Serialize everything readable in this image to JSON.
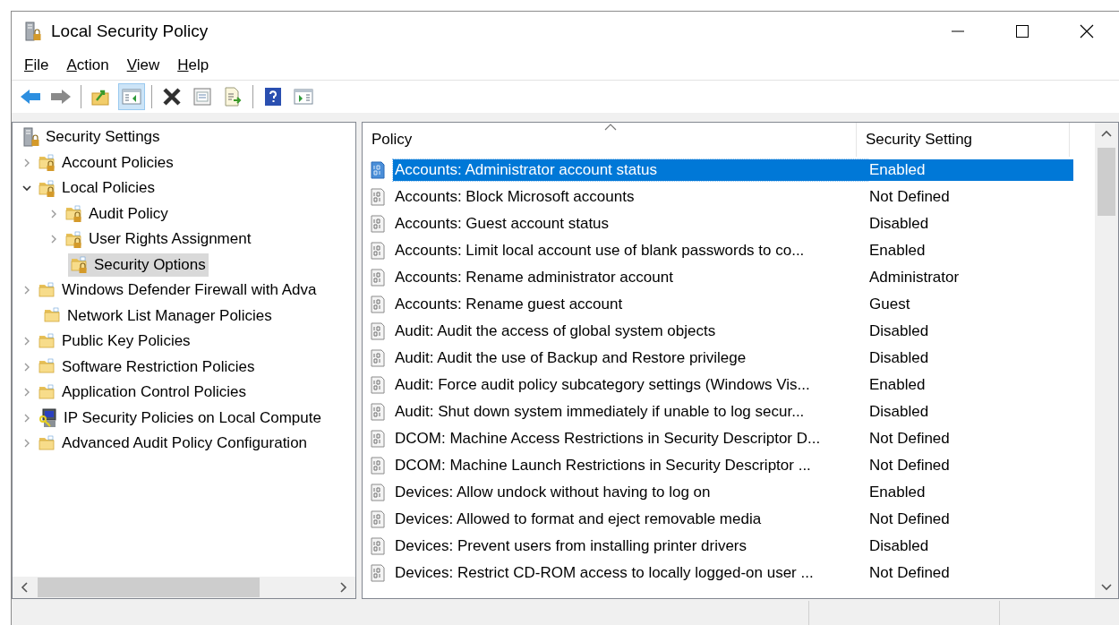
{
  "window": {
    "title": "Local Security Policy"
  },
  "menu": [
    {
      "label": "File"
    },
    {
      "label": "Action"
    },
    {
      "label": "View"
    },
    {
      "label": "Help"
    }
  ],
  "toolbar": [
    {
      "kind": "back",
      "pressed": false
    },
    {
      "kind": "forward",
      "pressed": false
    },
    {
      "kind": "separator"
    },
    {
      "kind": "up",
      "pressed": false
    },
    {
      "kind": "tree_toggle",
      "pressed": true
    },
    {
      "kind": "separator"
    },
    {
      "kind": "delete",
      "pressed": false
    },
    {
      "kind": "properties",
      "pressed": false
    },
    {
      "kind": "export",
      "pressed": false
    },
    {
      "kind": "separator"
    },
    {
      "kind": "help",
      "pressed": false
    },
    {
      "kind": "action_toggle",
      "pressed": false
    }
  ],
  "tree": [
    {
      "label": "Security Settings",
      "kind": "server",
      "selected": false,
      "children": [
        {
          "label": "Account Policies",
          "kind": "locked_folder",
          "expanded": false,
          "selected": false
        },
        {
          "label": "Local Policies",
          "kind": "locked_folder",
          "expanded": true,
          "selected": false,
          "children": [
            {
              "label": "Audit Policy",
              "kind": "locked_folder",
              "expanded": false,
              "selected": false
            },
            {
              "label": "User Rights Assignment",
              "kind": "locked_folder",
              "expanded": false,
              "selected": false
            },
            {
              "label": "Security Options",
              "kind": "locked_folder",
              "selected": true
            }
          ]
        },
        {
          "label": "Windows Defender Firewall with Adva",
          "kind": "folder",
          "expanded": false,
          "selected": false
        },
        {
          "label": "Network List Manager Policies",
          "kind": "folder",
          "selected": false
        },
        {
          "label": "Public Key Policies",
          "kind": "folder",
          "expanded": false,
          "selected": false
        },
        {
          "label": "Software Restriction Policies",
          "kind": "folder",
          "expanded": false,
          "selected": false
        },
        {
          "label": "Application Control Policies",
          "kind": "folder",
          "expanded": false,
          "selected": false
        },
        {
          "label": "IP Security Policies on Local Compute",
          "kind": "computer_key",
          "expanded": false,
          "selected": false
        },
        {
          "label": "Advanced Audit Policy Configuration",
          "kind": "folder",
          "expanded": false,
          "selected": false
        }
      ]
    }
  ],
  "table": {
    "columns": [
      {
        "label": "Policy",
        "sorted": true
      },
      {
        "label": "Security Setting",
        "sorted": false
      }
    ],
    "rows": [
      {
        "policy": "Accounts: Administrator account status",
        "setting": "Enabled",
        "selected": true
      },
      {
        "policy": "Accounts: Block Microsoft accounts",
        "setting": "Not Defined",
        "selected": false
      },
      {
        "policy": "Accounts: Guest account status",
        "setting": "Disabled",
        "selected": false
      },
      {
        "policy": "Accounts: Limit local account use of blank passwords to co...",
        "setting": "Enabled",
        "selected": false
      },
      {
        "policy": "Accounts: Rename administrator account",
        "setting": "Administrator",
        "selected": false
      },
      {
        "policy": "Accounts: Rename guest account",
        "setting": "Guest",
        "selected": false
      },
      {
        "policy": "Audit: Audit the access of global system objects",
        "setting": "Disabled",
        "selected": false
      },
      {
        "policy": "Audit: Audit the use of Backup and Restore privilege",
        "setting": "Disabled",
        "selected": false
      },
      {
        "policy": "Audit: Force audit policy subcategory settings (Windows Vis...",
        "setting": "Enabled",
        "selected": false
      },
      {
        "policy": "Audit: Shut down system immediately if unable to log secur...",
        "setting": "Disabled",
        "selected": false
      },
      {
        "policy": "DCOM: Machine Access Restrictions in Security Descriptor D...",
        "setting": "Not Defined",
        "selected": false
      },
      {
        "policy": "DCOM: Machine Launch Restrictions in Security Descriptor ...",
        "setting": "Not Defined",
        "selected": false
      },
      {
        "policy": "Devices: Allow undock without having to log on",
        "setting": "Enabled",
        "selected": false
      },
      {
        "policy": "Devices: Allowed to format and eject removable media",
        "setting": "Not Defined",
        "selected": false
      },
      {
        "policy": "Devices: Prevent users from installing printer drivers",
        "setting": "Disabled",
        "selected": false
      },
      {
        "policy": "Devices: Restrict CD-ROM access to locally logged-on user ...",
        "setting": "Not Defined",
        "selected": false
      }
    ]
  }
}
